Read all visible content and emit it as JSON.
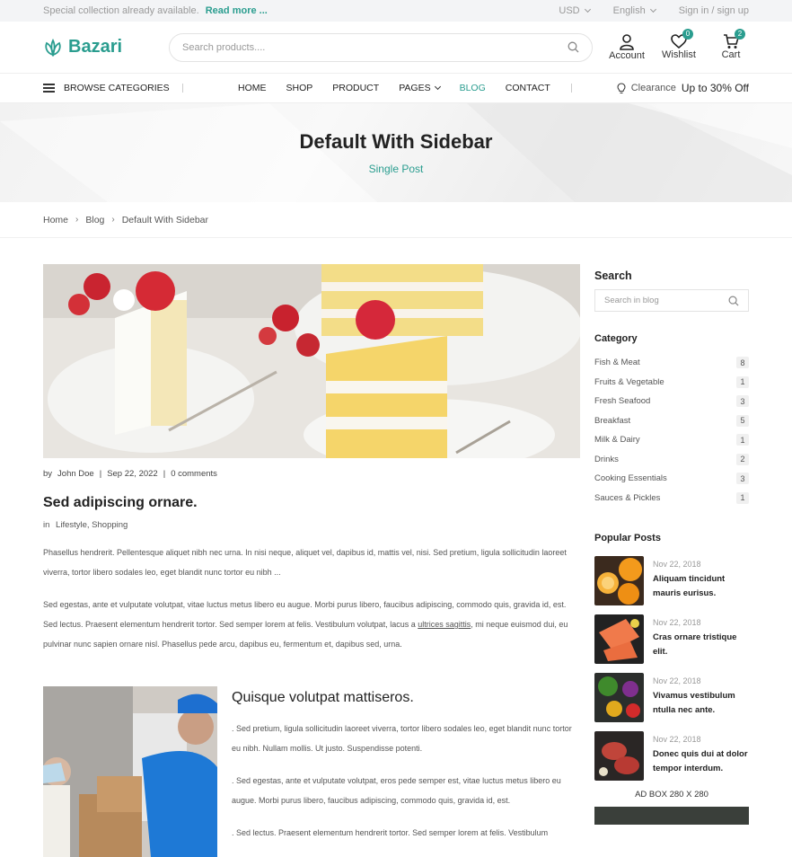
{
  "topbar": {
    "promo_text": "Special collection already available.",
    "promo_link": "Read more ...",
    "currency": "USD",
    "language": "English",
    "auth": "Sign in / sign up"
  },
  "header": {
    "logo": "Bazari",
    "search_placeholder": "Search products....",
    "account": "Account",
    "wishlist": "Wishlist",
    "wishlist_count": "0",
    "cart": "Cart",
    "cart_count": "2"
  },
  "nav": {
    "browse": "BROWSE CATEGORIES",
    "items": [
      "HOME",
      "SHOP",
      "PRODUCT",
      "PAGES",
      "BLOG",
      "CONTACT"
    ],
    "clearance": "Clearance",
    "clearance_offer": "Up to 30% Off"
  },
  "hero": {
    "title": "Default With Sidebar",
    "subtitle": "Single Post"
  },
  "breadcrumb": [
    "Home",
    "Blog",
    "Default With Sidebar"
  ],
  "post": {
    "by_label": "by",
    "author": "John Doe",
    "date": "Sep 22, 2022",
    "comments": "0 comments",
    "title": "Sed adipiscing ornare.",
    "in_label": "in",
    "categories": "Lifestyle,  Shopping",
    "para1": "Phasellus hendrerit. Pellentesque aliquet nibh nec urna. In nisi neque, aliquet vel, dapibus id, mattis vel, nisi. Sed pretium, ligula sollicitudin laoreet viverra, tortor libero sodales leo, eget blandit nunc tortor eu nibh ...",
    "para2_a": "Sed egestas, ante et vulputate volutpat, vitae luctus metus libero eu augue. Morbi purus libero, faucibus adipiscing, commodo quis, gravida id, est. Sed lectus. Praesent elementum hendrerit tortor. Sed semper lorem at felis. Vestibulum volutpat, lacus a",
    "para2_link": "ultrices sagittis",
    "para2_b": ", mi neque euismod dui, eu pulvinar nunc sapien ornare nisl. Phasellus pede arcu, dapibus eu, fermentum et, dapibus sed, urna."
  },
  "post2": {
    "title": "Quisque volutpat mattiseros.",
    "p1": ". Sed pretium, ligula sollicitudin laoreet viverra, tortor libero sodales leo, eget blandit nunc tortor eu nibh. Nullam mollis. Ut justo. Suspendisse potenti.",
    "p2": ". Sed egestas, ante et vulputate volutpat, eros pede semper est, vitae luctus metus libero eu augue. Morbi purus libero, faucibus adipiscing, commodo quis, gravida id, est.",
    "p3": ". Sed lectus. Praesent elementum hendrerit tortor. Sed semper lorem at felis. Vestibulum"
  },
  "sidebar": {
    "search_title": "Search",
    "search_placeholder": "Search in blog",
    "category_title": "Category",
    "categories": [
      {
        "name": "Fish & Meat",
        "count": "8"
      },
      {
        "name": "Fruits & Vegetable",
        "count": "1"
      },
      {
        "name": "Fresh Seafood",
        "count": "3"
      },
      {
        "name": "Breakfast",
        "count": "5"
      },
      {
        "name": "Milk & Dairy",
        "count": "1"
      },
      {
        "name": "Drinks",
        "count": "2"
      },
      {
        "name": "Cooking Essentials",
        "count": "3"
      },
      {
        "name": "Sauces & Pickles",
        "count": "1"
      }
    ],
    "popular_title": "Popular Posts",
    "popular": [
      {
        "date": "Nov 22, 2018",
        "title": "Aliquam tincidunt mauris eurisus."
      },
      {
        "date": "Nov 22, 2018",
        "title": "Cras ornare tristique elit."
      },
      {
        "date": "Nov 22, 2018",
        "title": "Vivamus vestibulum ntulla nec ante."
      },
      {
        "date": "Nov 22, 2018",
        "title": "Donec quis dui at dolor tempor interdum."
      }
    ],
    "ad_label": "AD BOX 280 X 280"
  },
  "colors": {
    "accent": "#2a9d8f",
    "text": "#222222",
    "muted": "#999999"
  }
}
